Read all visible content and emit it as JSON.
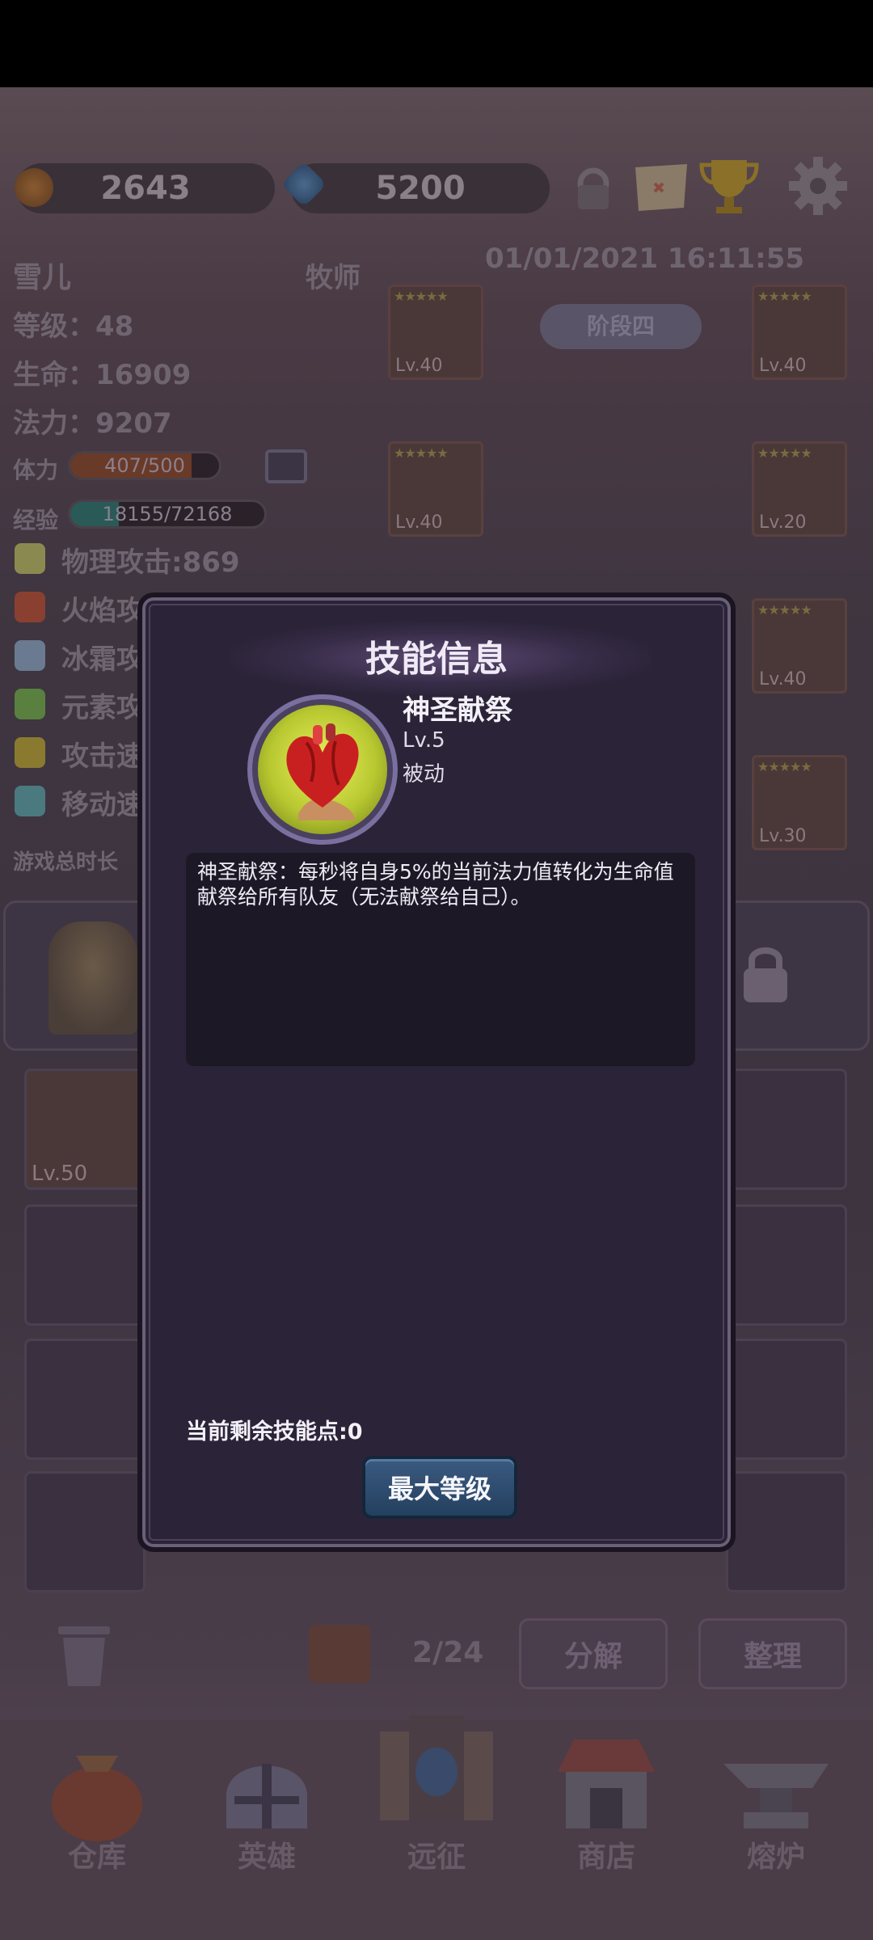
{
  "resources": {
    "gold": "2643",
    "gems": "5200"
  },
  "hero": {
    "name": "雪儿",
    "class": "牧师",
    "datetime": "01/01/2021 16:11:55",
    "stage": "阶段四",
    "level": "等级：48",
    "hp": "生命：16909",
    "mp": "法力：9207",
    "stamina_label": "体力",
    "stamina": "407/500",
    "stamina_fraction": 0.814,
    "exp_label": "经验",
    "exp": "18155/72168",
    "exp_fraction": 0.2516,
    "stats": [
      {
        "label": "物理攻击:869",
        "icon": "sword-icon",
        "color": "#8a8a50"
      },
      {
        "label": "火焰攻",
        "icon": "fire-icon",
        "color": "#8a4030"
      },
      {
        "label": "冰霜攻",
        "icon": "snowflake-icon",
        "color": "#6a7a90"
      },
      {
        "label": "元素攻",
        "icon": "potion-icon",
        "color": "#5a8040"
      },
      {
        "label": "攻击速",
        "icon": "lightning-icon",
        "color": "#8a7a30"
      },
      {
        "label": "移动速",
        "icon": "boot-icon",
        "color": "#4a7a80"
      }
    ],
    "playtime_label": "游戏总时长"
  },
  "gear": [
    {
      "slot": "helmet",
      "lv": "Lv.40",
      "icon": "helmet-icon"
    },
    {
      "slot": "ring",
      "lv": "Lv.40",
      "icon": "ring-icon"
    },
    {
      "slot": "necklace",
      "lv": "Lv.40",
      "icon": "necklace-icon"
    },
    {
      "slot": "armor",
      "lv": "Lv.20",
      "icon": "armor-icon"
    },
    {
      "slot": "boots",
      "lv": "Lv.40",
      "icon": "boots-icon"
    },
    {
      "slot": "book",
      "lv": "Lv.30",
      "icon": "book-icon"
    }
  ],
  "inventory": {
    "weapon_lv": "Lv.50",
    "count": "2/24",
    "decompose_label": "分解",
    "sort_label": "整理"
  },
  "nav": [
    {
      "label": "仓库",
      "icon": "bag-icon"
    },
    {
      "label": "英雄",
      "icon": "helmet-icon"
    },
    {
      "label": "远征",
      "icon": "portal-icon"
    },
    {
      "label": "商店",
      "icon": "shop-icon"
    },
    {
      "label": "熔炉",
      "icon": "anvil-icon"
    }
  ],
  "modal": {
    "title": "技能信息",
    "skill_name": "神圣献祭",
    "skill_level": "Lv.5",
    "skill_type": "被动",
    "description": "神圣献祭：每秒将自身5%的当前法力值转化为生命值献祭给所有队友（无法献祭给自己）。",
    "remaining_points": "当前剩余技能点:0",
    "max_button": "最大等级"
  }
}
